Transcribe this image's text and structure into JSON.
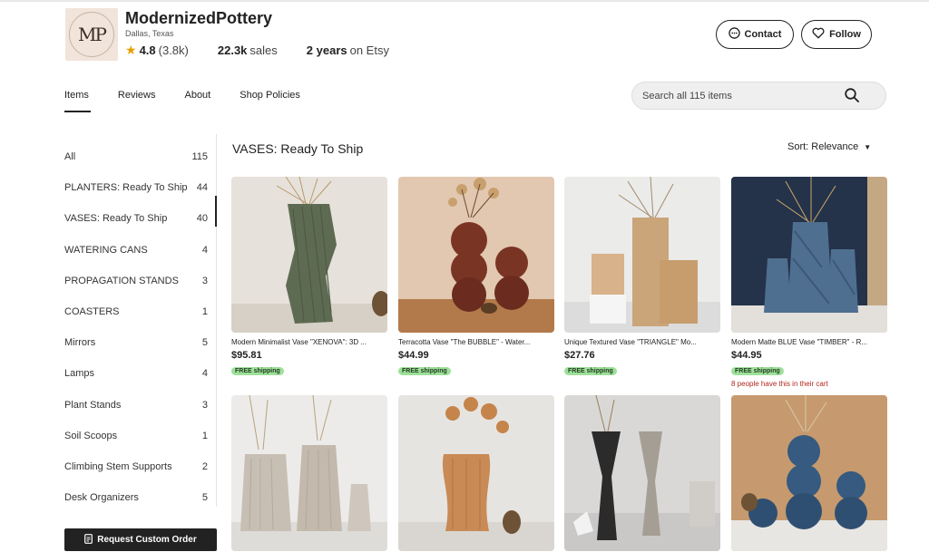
{
  "shop": {
    "logo_text": "MP",
    "name": "ModernizedPottery",
    "location": "Dallas, Texas",
    "rating": "4.8",
    "rating_count": "(3.8k)",
    "sales_num": "22.3k",
    "sales_label": "sales",
    "years_num": "2 years",
    "years_label": "on Etsy",
    "contact_label": "Contact",
    "follow_label": "Follow"
  },
  "tabs": [
    "Items",
    "Reviews",
    "About",
    "Shop Policies"
  ],
  "search": {
    "placeholder": "Search all 115 items"
  },
  "sidebar": {
    "items": [
      {
        "label": "All",
        "count": "115"
      },
      {
        "label": "PLANTERS: Ready To Ship",
        "count": "44"
      },
      {
        "label": "VASES: Ready To Ship",
        "count": "40"
      },
      {
        "label": "WATERING CANS",
        "count": "4"
      },
      {
        "label": "PROPAGATION STANDS",
        "count": "3"
      },
      {
        "label": "COASTERS",
        "count": "1"
      },
      {
        "label": "Mirrors",
        "count": "5"
      },
      {
        "label": "Lamps",
        "count": "4"
      },
      {
        "label": "Plant Stands",
        "count": "3"
      },
      {
        "label": "Soil Scoops",
        "count": "1"
      },
      {
        "label": "Climbing Stem Supports",
        "count": "2"
      },
      {
        "label": "Desk Organizers",
        "count": "5"
      }
    ],
    "request_label": "Request Custom Order"
  },
  "section": {
    "title": "VASES: Ready To Ship",
    "sort_label": "Sort: Relevance"
  },
  "products": [
    {
      "title": "Modern Minimalist Vase \"XENOVA\": 3D ...",
      "price": "$95.81",
      "ship": "FREE shipping"
    },
    {
      "title": "Terracotta Vase \"The BUBBLE\" - Water...",
      "price": "$44.99",
      "ship": "FREE shipping"
    },
    {
      "title": "Unique Textured Vase \"TRIANGLE\" Mo...",
      "price": "$27.76",
      "ship": "FREE shipping"
    },
    {
      "title": "Modern Matte BLUE Vase \"TIMBER\" - R...",
      "price": "$44.95",
      "ship": "FREE shipping",
      "note": "8 people have this in their cart"
    }
  ],
  "colors": {
    "accent_dark": "#222222",
    "free_shipping_bg": "#9ee09a",
    "cart_note": "#b3261e",
    "star": "#e8a000"
  },
  "icons": {
    "rating": "star-icon",
    "contact": "chat-bubble-icon",
    "follow": "heart-icon",
    "search": "search-icon",
    "request": "document-icon",
    "sort": "caret-down-icon"
  }
}
